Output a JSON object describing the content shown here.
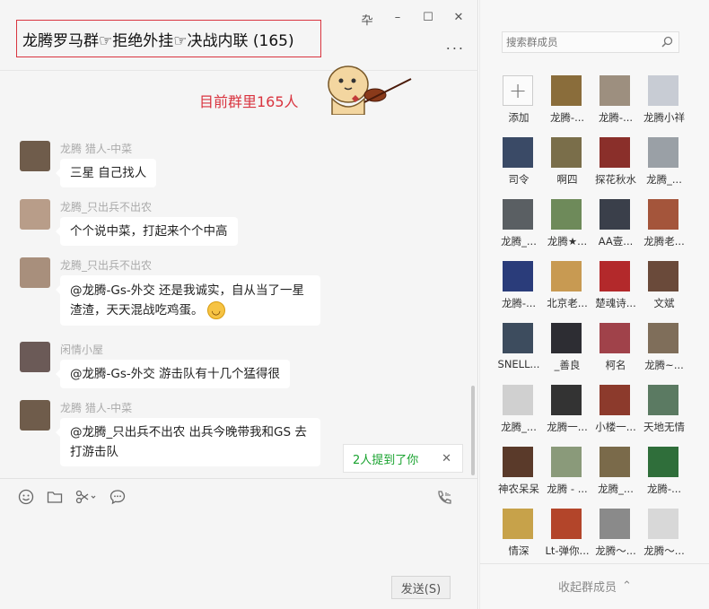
{
  "window": {
    "title": "龙腾罗马群☞拒绝外挂☞决战内联 (165)",
    "pin_icon": "卆",
    "minimize_icon": "–",
    "maximize_icon": "☐",
    "close_icon": "✕",
    "more_icon": "..."
  },
  "announcement": "目前群里165人",
  "messages": [
    {
      "sender": "龙腾 猎人-中菜",
      "text": "三星 自己找人",
      "avatar_color": "#6f5c4b"
    },
    {
      "sender": "龙腾_只出兵不出农",
      "text": "个个说中菜，打起来个个中高",
      "avatar_color": "#b89d89"
    },
    {
      "sender": "龙腾_只出兵不出农",
      "text_line1": "@龙腾-Gs-外交 还是我诚实，自从当了一星",
      "text_line2": "渣渣，天天混战吃鸡蛋。",
      "emoji": "😁",
      "avatar_color": "#a88f7c"
    },
    {
      "sender": "闲情小屋",
      "text": "@龙腾-Gs-外交 游击队有十几个猛得很",
      "avatar_color": "#6b5a57"
    },
    {
      "sender": "龙腾 猎人-中菜",
      "text_line1": "@龙腾_只出兵不出农 出兵今晚带我和GS 去",
      "text_line2": "打游击队",
      "avatar_color": "#6f5c4b"
    }
  ],
  "mention_notice": {
    "text": "2人提到了你",
    "close": "✕"
  },
  "composer": {
    "send_label": "发送(S)"
  },
  "members_panel": {
    "search_placeholder": "搜索群成员",
    "collapse_label": "收起群成员",
    "collapse_icon": "⌃",
    "add_label": "添加",
    "members": [
      {
        "name": "龙腾-...",
        "color": "#8a6d3b"
      },
      {
        "name": "龙腾-...",
        "color": "#9d8f7f"
      },
      {
        "name": "龙腾小祥",
        "color": "#c8ccd4"
      },
      {
        "name": "司令",
        "color": "#3a4a66"
      },
      {
        "name": "啊四",
        "color": "#7a6e4a"
      },
      {
        "name": "探花秋水",
        "color": "#8a2f2a"
      },
      {
        "name": "龙腾_...",
        "color": "#9aa0a6"
      },
      {
        "name": "龙腾_...",
        "color": "#5a5f63"
      },
      {
        "name": "龙腾★...",
        "color": "#6e8a5a"
      },
      {
        "name": "AA壹...",
        "color": "#3a3f4a"
      },
      {
        "name": "龙腾老...",
        "color": "#a4553b"
      },
      {
        "name": "龙腾-...",
        "color": "#2a3c7a"
      },
      {
        "name": "北京老...",
        "color": "#c89a52"
      },
      {
        "name": "楚魂诗...",
        "color": "#b3292b"
      },
      {
        "name": "文斌",
        "color": "#6a4a3a"
      },
      {
        "name": "SNELL...",
        "color": "#3d4c5e"
      },
      {
        "name": "_善良",
        "color": "#2d2d33"
      },
      {
        "name": "柯名",
        "color": "#a0424a"
      },
      {
        "name": "龙腾~...",
        "color": "#7f6e5a"
      },
      {
        "name": "龙腾_...",
        "color": "#d0d0d0"
      },
      {
        "name": "龙腾一...",
        "color": "#333333"
      },
      {
        "name": "小楼一...",
        "color": "#8c3a2c"
      },
      {
        "name": "天地无情",
        "color": "#5b7a62"
      },
      {
        "name": "神农呆呆",
        "color": "#5a3a2a"
      },
      {
        "name": "龙腾 - ...",
        "color": "#8a9a7a"
      },
      {
        "name": "龙腾_...",
        "color": "#7a6a4a"
      },
      {
        "name": "龙腾-...",
        "color": "#2f6e3a"
      },
      {
        "name": "情深",
        "color": "#c7a24a"
      },
      {
        "name": "Lt-弹你...",
        "color": "#b3452a"
      },
      {
        "name": "龙腾～...",
        "color": "#8a8a8a"
      },
      {
        "name": "龙腾～...",
        "color": "#d8d8d8"
      }
    ]
  }
}
